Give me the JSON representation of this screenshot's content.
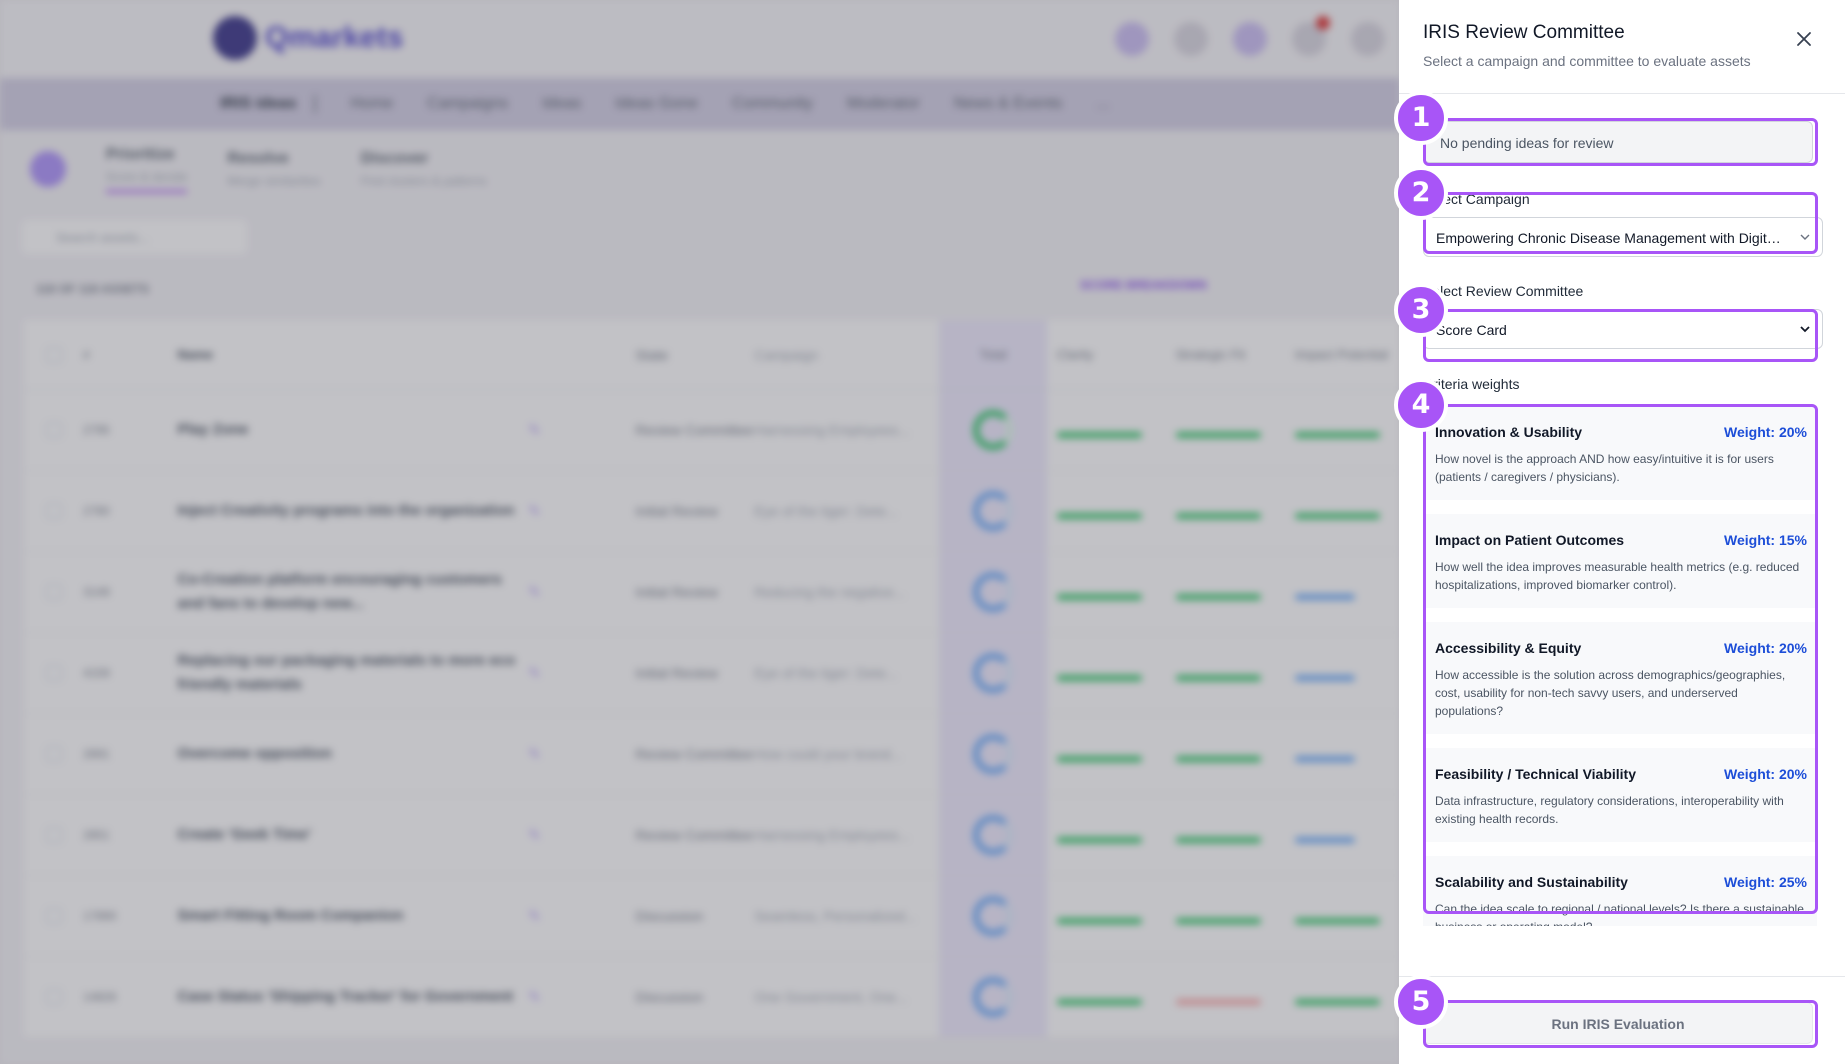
{
  "app": {
    "logo_text": "Qmarkets",
    "nav": [
      "Home",
      "Campaigns",
      "Ideas",
      "Ideas Gone",
      "Community",
      "Moderator",
      "News & Events",
      "..."
    ],
    "nav_brand": "IRIS ideas",
    "subtabs": [
      {
        "title": "Prioritize",
        "subtitle": "Score & decide"
      },
      {
        "title": "Resolve",
        "subtitle": "Merge similarities"
      },
      {
        "title": "Discover",
        "subtitle": "Find clusters & patterns"
      }
    ],
    "search_placeholder": "Search assets...",
    "assets_count": "118 OF 118 ASSETS",
    "score_breakdown": "SCORE BREAKDOWN",
    "columns": [
      "#",
      "Name",
      "State",
      "Campaign",
      "Total",
      "Clarity",
      "Strategic Fit",
      "Impact Potential"
    ],
    "rows": [
      {
        "num": "2795",
        "name": "Play Zone",
        "state": "Review Committee",
        "campaign": "Harnessing Employees..."
      },
      {
        "num": "2780",
        "name": "Inject Creativity programs into the organization",
        "state": "Initial Review",
        "campaign": "Eye of the tiger: Dete..."
      },
      {
        "num": "3149",
        "name": "Co-Creation platform encouraging customers and fans to develop new...",
        "state": "Initial Review",
        "campaign": "Reducing the negative..."
      },
      {
        "num": "4159",
        "name": "Replacing our packaging materials to more eco friendly materials",
        "state": "Initial Review",
        "campaign": "Eye of the tiger: Dete..."
      },
      {
        "num": "2891",
        "name": "Overcome opposition",
        "state": "Review Committee",
        "campaign": "How could your brand..."
      },
      {
        "num": "2851",
        "name": "Create 'Geek Time'",
        "state": "Review Committee",
        "campaign": "Harnessing Employees..."
      },
      {
        "num": "17890",
        "name": "Smart Fitting Room Companion",
        "state": "Discussion",
        "campaign": "Seamless, Personalized..."
      },
      {
        "num": "14826",
        "name": "Case Status 'Shipping Tracker' for Government",
        "state": "Discussion",
        "campaign": "One Government, One..."
      }
    ]
  },
  "panel": {
    "title": "IRIS Review Committee",
    "subtitle": "Select a campaign and committee to evaluate assets",
    "pending_text": "No pending ideas for review",
    "campaign_label": "Select Campaign",
    "campaign_value": "Empowering Chronic Disease Management with Digital Health",
    "committee_label": "Select Review Committee",
    "committee_value": "Score Card",
    "criteria_label": "Criteria weights",
    "criteria": [
      {
        "name": "Innovation & Usability",
        "weight": "Weight: 20%",
        "desc": "How novel is the approach AND how easy/intuitive it is for users (patients / caregivers / physicians)."
      },
      {
        "name": "Impact on Patient Outcomes",
        "weight": "Weight: 15%",
        "desc": "How well the idea improves measurable health metrics (e.g. reduced hospitalizations, improved biomarker control)."
      },
      {
        "name": "Accessibility & Equity",
        "weight": "Weight: 20%",
        "desc": "How accessible is the solution across demographics/geographies, cost, usability for non-tech savvy users, and underserved populations?"
      },
      {
        "name": "Feasibility / Technical Viability",
        "weight": "Weight: 20%",
        "desc": "Data infrastructure, regulatory considerations, interoperability with existing health records."
      },
      {
        "name": "Scalability and Sustainability",
        "weight": "Weight: 25%",
        "desc": "Can the idea scale to regional / national levels? Is there a sustainable business or operating model?"
      }
    ],
    "run_label": "Run IRIS Evaluation"
  },
  "callouts": [
    "1",
    "2",
    "3",
    "4",
    "5"
  ],
  "colors": {
    "accent": "#a855f7",
    "weight_blue": "#1d4ed8"
  }
}
